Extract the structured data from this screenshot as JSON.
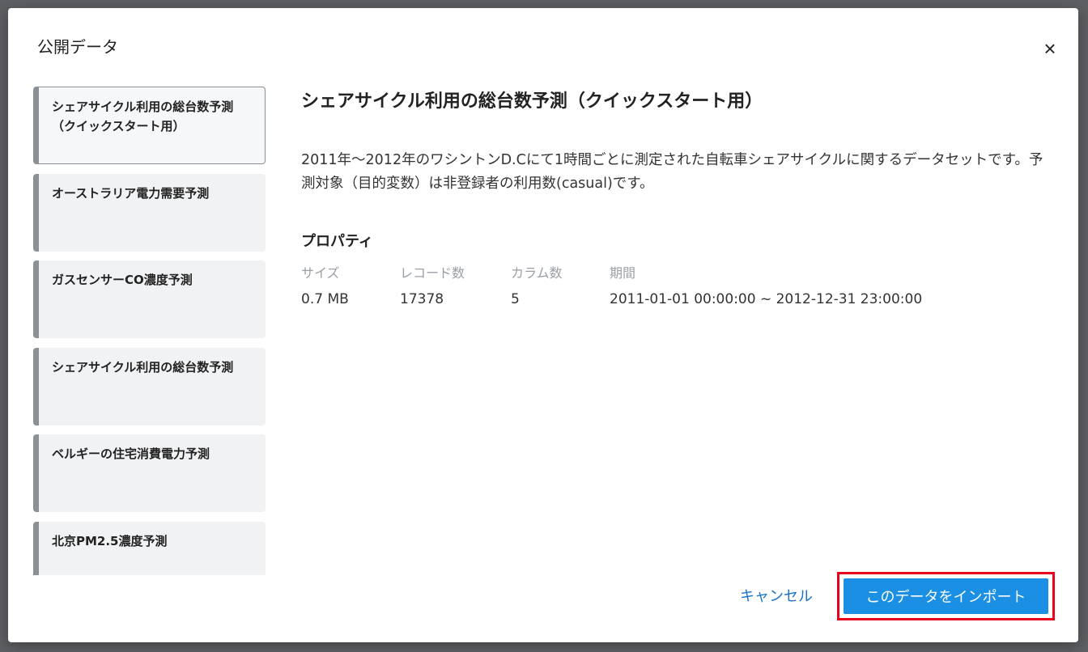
{
  "modal": {
    "title": "公開データ",
    "close_label": "×"
  },
  "datasets": [
    {
      "label": "シェアサイクル利用の総台数予測\n（クイックスタート用）",
      "selected": true
    },
    {
      "label": "オーストラリア電力需要予測",
      "selected": false
    },
    {
      "label": "ガスセンサーCO濃度予測",
      "selected": false
    },
    {
      "label": "シェアサイクル利用の総台数予測",
      "selected": false
    },
    {
      "label": "ベルギーの住宅消費電力予測",
      "selected": false
    },
    {
      "label": "北京PM2.5濃度予測",
      "selected": false
    }
  ],
  "detail": {
    "title": "シェアサイクル利用の総台数予測（クイックスタート用）",
    "description": "2011年～2012年のワシントンD.Cにて1時間ごとに測定された自転車シェアサイクルに関するデータセットです。予測対象（目的変数）は非登録者の利用数(casual)です。",
    "properties_heading": "プロパティ",
    "properties": {
      "size_label": "サイズ",
      "size_value": "0.7 MB",
      "records_label": "レコード数",
      "records_value": "17378",
      "columns_label": "カラム数",
      "columns_value": "5",
      "period_label": "期間",
      "period_value": "2011-01-01 00:00:00 ~ 2012-12-31 23:00:00"
    }
  },
  "footer": {
    "cancel_label": "キャンセル",
    "import_label": "このデータをインポート"
  },
  "colors": {
    "primary": "#1a8fe3",
    "highlight": "#e8001c",
    "link": "#1a73c8"
  }
}
